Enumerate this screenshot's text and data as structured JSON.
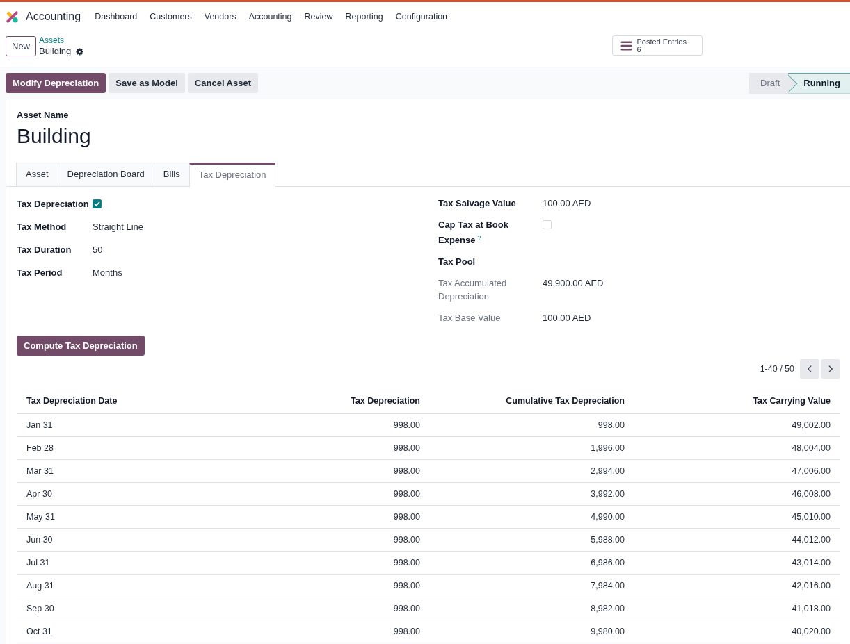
{
  "navbar": {
    "app_name": "Accounting",
    "menu": [
      "Dashboard",
      "Customers",
      "Vendors",
      "Accounting",
      "Review",
      "Reporting",
      "Configuration"
    ]
  },
  "control_panel": {
    "new_button": "New",
    "breadcrumb": {
      "parent": "Assets",
      "current": "Building"
    },
    "smart_button": {
      "label": "Posted Entries",
      "count": "6"
    },
    "actions": [
      {
        "label": "Modify Depreciation",
        "kind": "primary"
      },
      {
        "label": "Save as Model",
        "kind": "secondary"
      },
      {
        "label": "Cancel Asset",
        "kind": "secondary"
      }
    ],
    "status_bar": [
      {
        "label": "Draft",
        "selected": false
      },
      {
        "label": "Running",
        "selected": true
      }
    ]
  },
  "form": {
    "name_label": "Asset Name",
    "name": "Building",
    "tabs": [
      {
        "label": "Asset",
        "selected": false
      },
      {
        "label": "Depreciation Board",
        "selected": false
      },
      {
        "label": "Bills",
        "selected": false
      },
      {
        "label": "Tax Depreciation",
        "selected": true
      }
    ],
    "left_fields": [
      {
        "label": "Tax Depreciation",
        "kind": "checkbox",
        "checked": true,
        "readonly": false
      },
      {
        "label": "Tax Method",
        "kind": "text",
        "value": "Straight Line",
        "readonly": false
      },
      {
        "label": "Tax Duration",
        "kind": "text",
        "value": "50",
        "readonly": false
      },
      {
        "label": "Tax Period",
        "kind": "text",
        "value": "Months",
        "readonly": false
      }
    ],
    "right_fields": [
      {
        "label": "Tax Salvage Value",
        "kind": "text",
        "value": "100.00 AED",
        "readonly": false
      },
      {
        "label": "Cap Tax at Book Expense$^{?}$",
        "kind": "checkbox",
        "checked": false,
        "readonly": false
      },
      {
        "label": "Tax Pool",
        "kind": "text",
        "readonly": false
      },
      {
        "label": "Tax Accumulated Depreciation",
        "kind": "text",
        "value": "49,900.00 AED",
        "readonly": true
      },
      {
        "label": "Tax Base Value",
        "kind": "text",
        "value": "100.00 AED",
        "readonly": true
      }
    ],
    "compute_button": "Compute Tax Depreciation",
    "pager": {
      "range": "1-40 / 50"
    },
    "table": {
      "columns": [
        "Tax Depreciation Date",
        "Tax Depreciation",
        "Cumulative Tax Depreciation",
        "Tax Carrying Value"
      ],
      "rows": [
        [
          "Jan 31",
          "998.00",
          "998.00",
          "49,002.00"
        ],
        [
          "Feb 28",
          "998.00",
          "1,996.00",
          "48,004.00"
        ],
        [
          "Mar 31",
          "998.00",
          "2,994.00",
          "47,006.00"
        ],
        [
          "Apr 30",
          "998.00",
          "3,992.00",
          "46,008.00"
        ],
        [
          "May 31",
          "998.00",
          "4,990.00",
          "45,010.00"
        ],
        [
          "Jun 30",
          "998.00",
          "5,988.00",
          "44,012.00"
        ],
        [
          "Jul 31",
          "998.00",
          "6,986.00",
          "43,014.00"
        ],
        [
          "Aug 31",
          "998.00",
          "7,984.00",
          "42,016.00"
        ],
        [
          "Sep 30",
          "998.00",
          "8,982.00",
          "41,018.00"
        ],
        [
          "Oct 31",
          "998.00",
          "9,980.00",
          "40,020.00"
        ]
      ]
    }
  }
}
